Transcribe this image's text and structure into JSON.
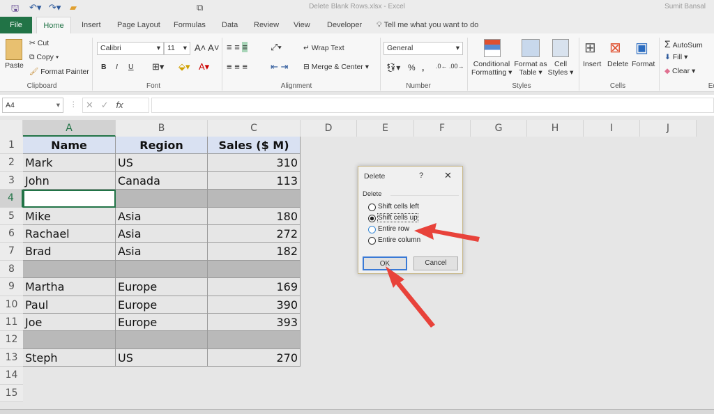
{
  "window": {
    "title": "Delete Blank Rows.xlsx  -  Excel",
    "user": "Sumit Bansal"
  },
  "tabs": [
    "File",
    "Home",
    "Insert",
    "Page Layout",
    "Formulas",
    "Data",
    "Review",
    "View",
    "Developer"
  ],
  "tell_me": "Tell me what you want to do",
  "ribbon": {
    "clipboard": {
      "paste": "Paste",
      "cut": "Cut",
      "copy": "Copy",
      "format_painter": "Format Painter",
      "label": "Clipboard"
    },
    "font": {
      "name": "Calibri",
      "size": "11",
      "bold": "B",
      "italic": "I",
      "underline": "U",
      "label": "Font"
    },
    "alignment": {
      "wrap_text": "Wrap Text",
      "merge_center": "Merge & Center",
      "label": "Alignment"
    },
    "number": {
      "format": "General",
      "percent": "%",
      "comma": ",",
      "label": "Number"
    },
    "styles": {
      "conditional": "Conditional",
      "conditional2": "Formatting",
      "format_as": "Format as",
      "format_as2": "Table",
      "cell": "Cell",
      "cell2": "Styles",
      "label": "Styles"
    },
    "cells": {
      "insert": "Insert",
      "delete": "Delete",
      "format": "Format",
      "label": "Cells"
    },
    "editing": {
      "autosum": "AutoSum",
      "fill": "Fill",
      "clear": "Clear",
      "label": "Edi"
    }
  },
  "formula_bar": {
    "name_box": "A4",
    "fx": "fx",
    "value": ""
  },
  "columns": [
    "A",
    "B",
    "C",
    "D",
    "E",
    "F",
    "G",
    "H",
    "I",
    "J"
  ],
  "selected_column": "A",
  "rows": [
    {
      "n": "1",
      "a": "Name",
      "b": "Region",
      "c": "Sales ($ M)",
      "type": "header"
    },
    {
      "n": "2",
      "a": "Mark",
      "b": "US",
      "c": "310"
    },
    {
      "n": "3",
      "a": "John",
      "b": "Canada",
      "c": "113"
    },
    {
      "n": "4",
      "a": "",
      "b": "",
      "c": "",
      "type": "blank"
    },
    {
      "n": "5",
      "a": "Mike",
      "b": "Asia",
      "c": "180"
    },
    {
      "n": "6",
      "a": "Rachael",
      "b": "Asia",
      "c": "272"
    },
    {
      "n": "7",
      "a": "Brad",
      "b": "Asia",
      "c": "182"
    },
    {
      "n": "8",
      "a": "",
      "b": "",
      "c": "",
      "type": "blank"
    },
    {
      "n": "9",
      "a": "Martha",
      "b": "Europe",
      "c": "169"
    },
    {
      "n": "10",
      "a": "Paul",
      "b": "Europe",
      "c": "390"
    },
    {
      "n": "11",
      "a": "Joe",
      "b": "Europe",
      "c": "393"
    },
    {
      "n": "12",
      "a": "",
      "b": "",
      "c": "",
      "type": "blank"
    },
    {
      "n": "13",
      "a": "Steph",
      "b": "US",
      "c": "270"
    },
    {
      "n": "14"
    },
    {
      "n": "15"
    }
  ],
  "dialog": {
    "title": "Delete",
    "help": "?",
    "close": "✕",
    "group": "Delete",
    "options": [
      "Shift cells left",
      "Shift cells up",
      "Entire row",
      "Entire column"
    ],
    "selected": "Shift cells up",
    "ok": "OK",
    "cancel": "Cancel"
  },
  "colors": {
    "excel_green": "#217346",
    "header_fill": "#d9e1f2",
    "blank_fill": "#b9b9b9",
    "arrow": "#e8423a"
  }
}
